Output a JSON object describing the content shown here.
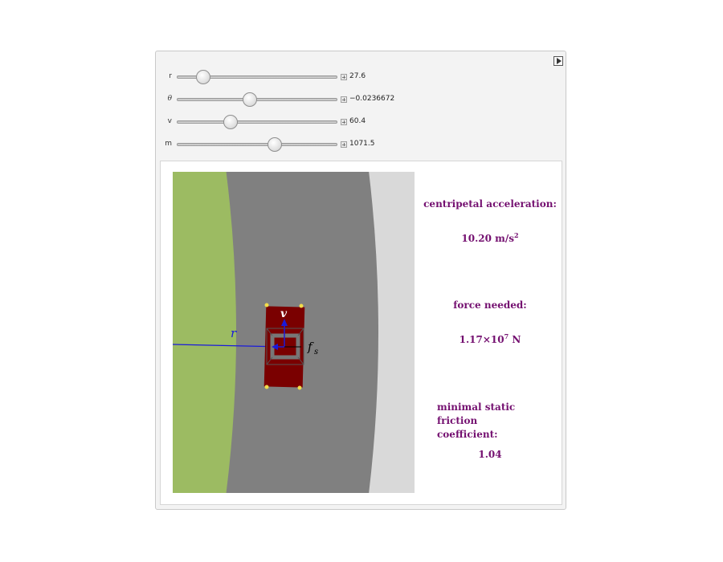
{
  "controls": [
    {
      "label": "r",
      "value": "27.6",
      "thumb_fraction": 0.13
    },
    {
      "label": "θ",
      "value": "−0.0236672",
      "thumb_fraction": 0.45
    },
    {
      "label": "v",
      "value": "60.4",
      "thumb_fraction": 0.32
    },
    {
      "label": "m",
      "value": "1071.5",
      "thumb_fraction": 0.62
    }
  ],
  "scene": {
    "labels": {
      "r": "r",
      "v": "v",
      "fs": "f",
      "fs_sub": "s"
    },
    "colors": {
      "grass": "#9cbb62",
      "road": "#808080",
      "shoulder": "#d9d9d9",
      "car": "#7a0000",
      "vector": "#1a1adb"
    }
  },
  "results": {
    "accel_label": "centripetal acceleration:",
    "accel_value": "10.20 m/s",
    "accel_exp": "2",
    "force_label": "force needed:",
    "force_value": "1.17×10",
    "force_exp": "7",
    "force_unit": " N",
    "friction_label_1": "minimal static friction",
    "friction_label_2": "coefficient:",
    "friction_value": "1.04"
  },
  "colors": {
    "text": "#741070"
  }
}
